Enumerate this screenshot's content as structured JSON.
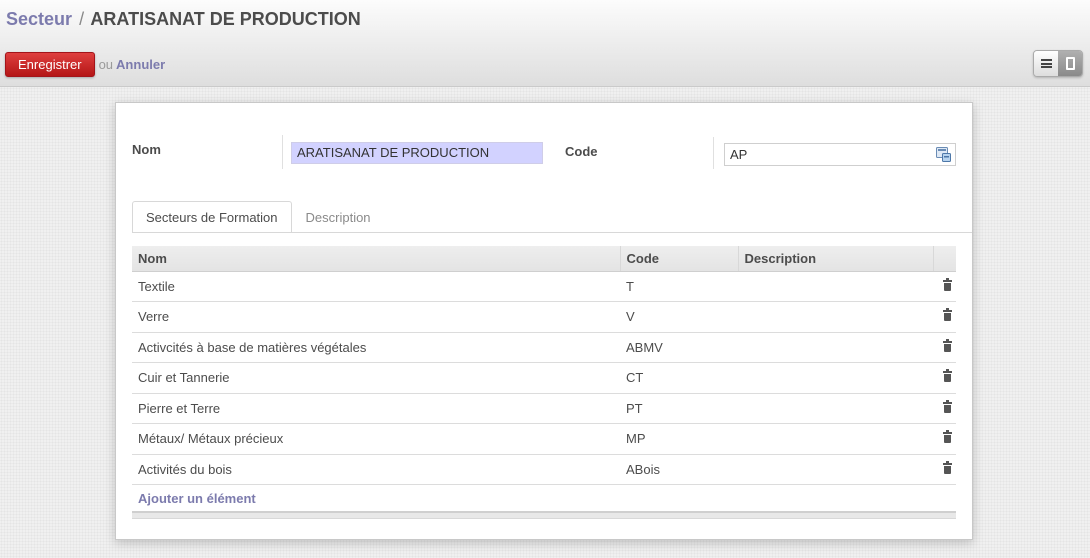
{
  "breadcrumb": {
    "parent": "Secteur",
    "separator": "/",
    "current": "ARATISANAT DE PRODUCTION"
  },
  "actions": {
    "save_label": "Enregistrer",
    "or_text": "ou",
    "discard_label": "Annuler"
  },
  "view_switcher": {
    "views": [
      "list-view-icon",
      "form-view-icon"
    ],
    "active": "form-view-icon"
  },
  "form": {
    "name_label": "Nom",
    "name_value": "ARATISANAT DE PRODUCTION",
    "code_label": "Code",
    "code_value": "AP"
  },
  "tabs": [
    {
      "label": "Secteurs de Formation",
      "active": true
    },
    {
      "label": "Description",
      "active": false
    }
  ],
  "grid": {
    "columns": [
      "Nom",
      "Code",
      "Description"
    ],
    "rows": [
      {
        "nom": "Textile",
        "code": "T",
        "description": ""
      },
      {
        "nom": "Verre",
        "code": "V",
        "description": ""
      },
      {
        "nom": "Activcités à base de matières végétales",
        "code": "ABMV",
        "description": ""
      },
      {
        "nom": "Cuir et Tannerie",
        "code": "CT",
        "description": ""
      },
      {
        "nom": "Pierre et Terre",
        "code": "PT",
        "description": ""
      },
      {
        "nom": "Métaux/ Métaux précieux",
        "code": "MP",
        "description": ""
      },
      {
        "nom": "Activités du bois",
        "code": "ABois",
        "description": ""
      }
    ],
    "add_label": "Ajouter un élément"
  },
  "colors": {
    "accent": "#7c7bad",
    "save_button": "#c9282d",
    "name_highlight": "#d2d2ff"
  }
}
